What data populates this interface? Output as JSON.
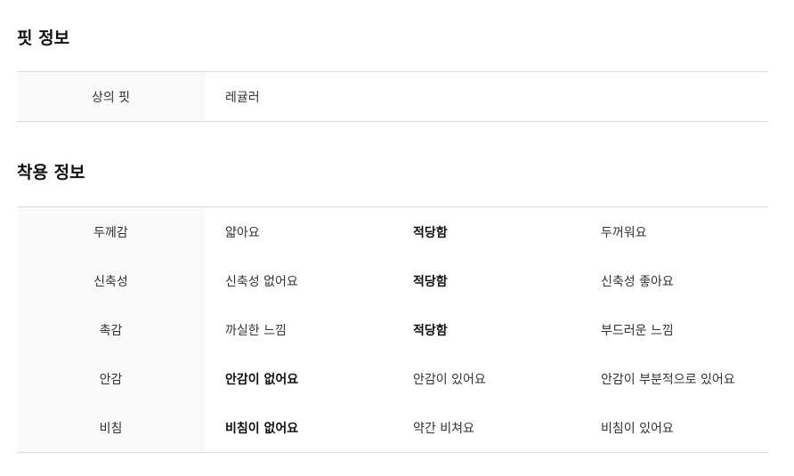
{
  "fit_section": {
    "title": "핏 정보",
    "rows": [
      {
        "label": "상의 핏",
        "value": "레귤러"
      }
    ]
  },
  "wear_section": {
    "title": "착용 정보",
    "rows": [
      {
        "label": "두께감",
        "options": [
          "얇아요",
          "적당함",
          "두꺼워요"
        ],
        "selected_index": 1
      },
      {
        "label": "신축성",
        "options": [
          "신축성 없어요",
          "적당함",
          "신축성 좋아요"
        ],
        "selected_index": 1
      },
      {
        "label": "촉감",
        "options": [
          "까실한 느낌",
          "적당함",
          "부드러운 느낌"
        ],
        "selected_index": 1
      },
      {
        "label": "안감",
        "options": [
          "안감이 없어요",
          "안감이 있어요",
          "안감이 부분적으로 있어요"
        ],
        "selected_index": 0
      },
      {
        "label": "비침",
        "options": [
          "비침이 없어요",
          "약간 비쳐요",
          "비침이 있어요"
        ],
        "selected_index": 0
      }
    ]
  }
}
